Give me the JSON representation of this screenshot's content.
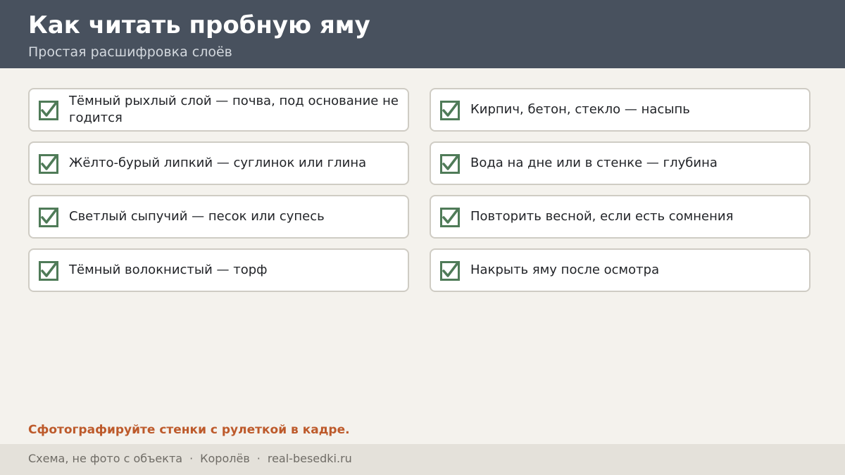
{
  "header": {
    "title": "Как читать пробную яму",
    "subtitle": "Простая расшифровка слоёв"
  },
  "checklist": {
    "left": [
      {
        "text": "Тёмный рыхлый слой — почва, под основание не годится",
        "checked": true
      },
      {
        "text": "Жёлто-бурый липкий — суглинок или глина",
        "checked": true
      },
      {
        "text": "Светлый сыпучий — песок или супесь",
        "checked": true
      },
      {
        "text": "Тёмный волокнистый — торф",
        "checked": true
      }
    ],
    "right": [
      {
        "text": "Кирпич, бетон, стекло — насыпь",
        "checked": true
      },
      {
        "text": "Вода на дне или в стенке — глубина",
        "checked": true
      },
      {
        "text": "Повторить весной, если есть сомнения",
        "checked": true
      },
      {
        "text": "Накрыть яму после осмотра",
        "checked": true
      }
    ]
  },
  "tip": "Сфотографируйте стенки с рулеткой в кадре.",
  "footer": {
    "parts": [
      "Схема, не фото с объекта",
      "Королёв",
      "real-besedki.ru"
    ],
    "separator": "·"
  },
  "colors": {
    "header_bg": "#48515e",
    "check_green": "#4f7b58",
    "tip_orange": "#bd5a2b"
  },
  "icons": {
    "check": "checkbox-checked-icon"
  }
}
